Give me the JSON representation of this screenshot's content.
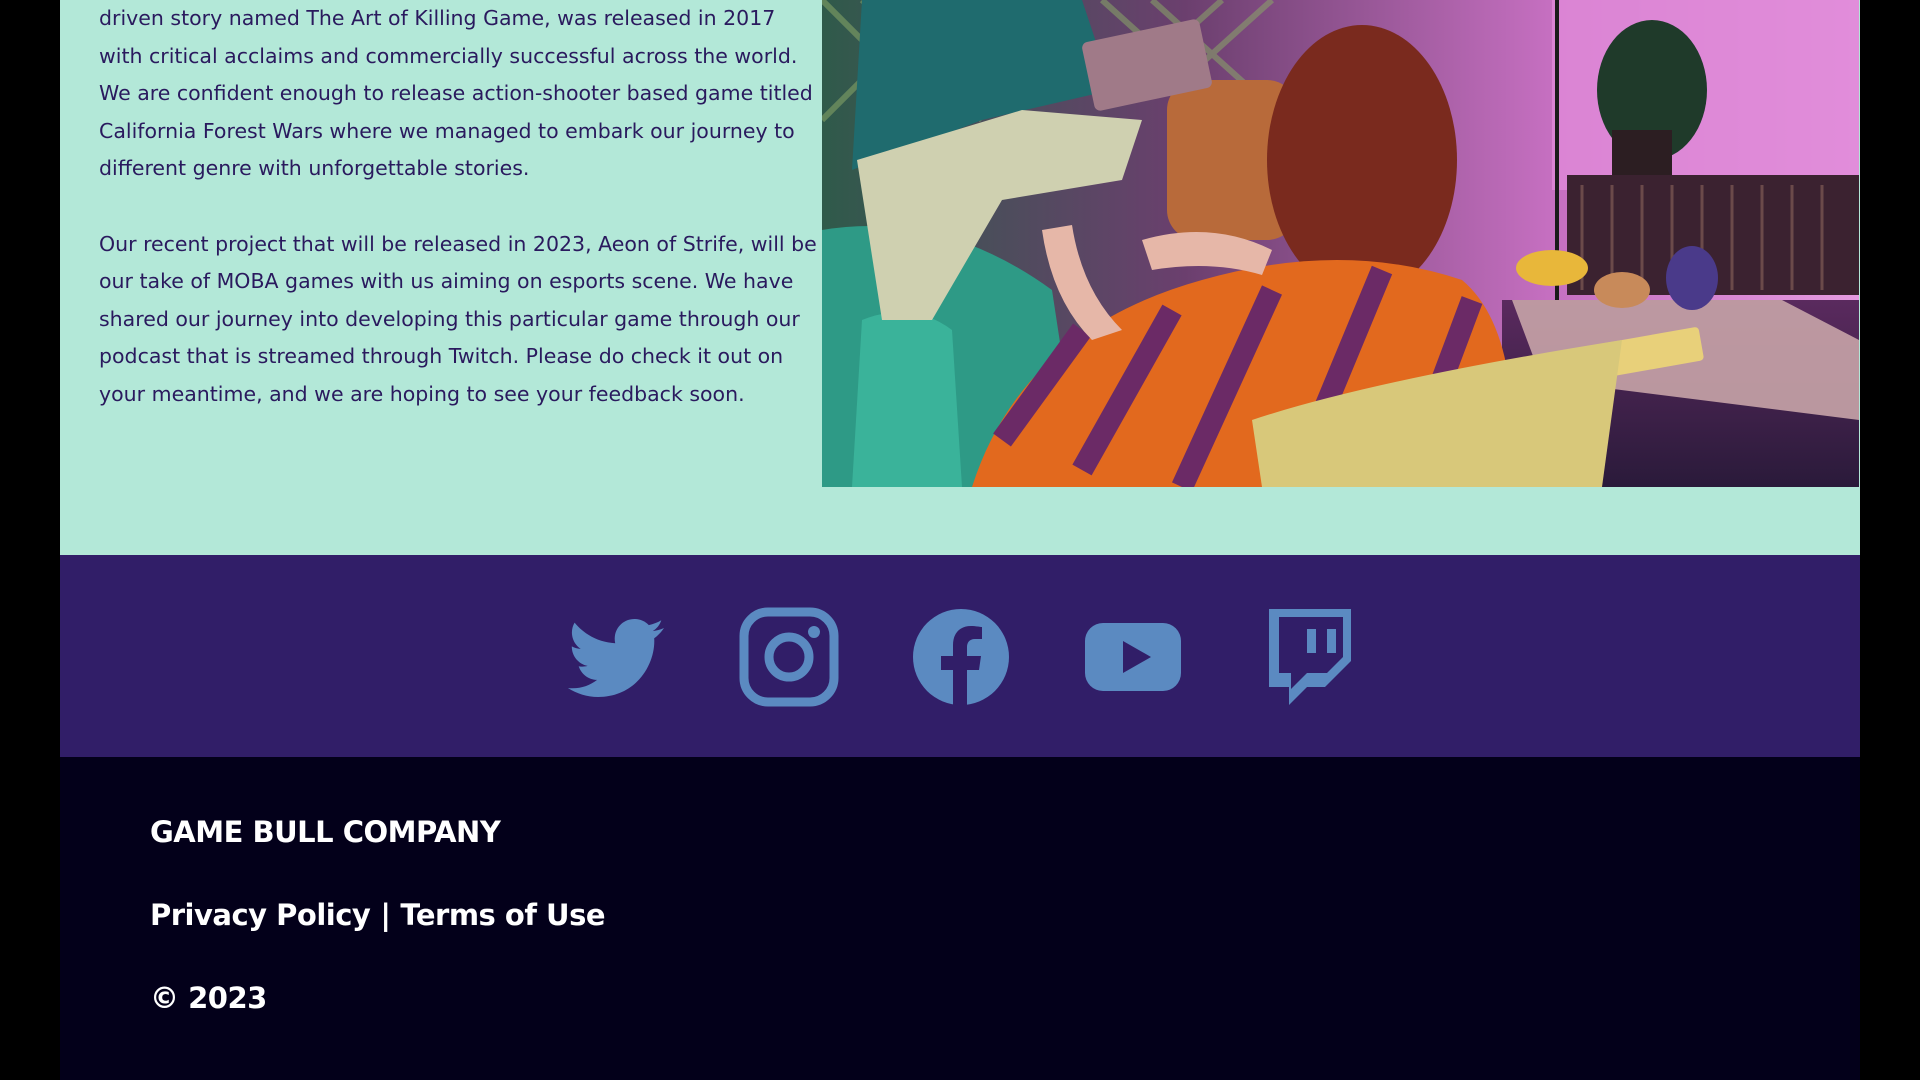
{
  "about": {
    "paragraph1": "driven story named The Art of Killing Game, was released in 2017 with critical acclaims and commercially successful across the world. We are confident enough to release action-shooter based game titled California Forest Wars where we managed to embark our journey to different genre with unforgettable stories.",
    "paragraph2": "Our recent project that will be released in 2023, Aeon of Strife, will be our take of MOBA games with us aiming on esports scene. We have shared our journey into developing this particular game through our podcast that is streamed through Twitch. Please do check it out on your meantime, and we are hoping to see your feedback soon."
  },
  "photo": {
    "subject": "people-in-living-room"
  },
  "social": {
    "icon_color": "#5b8ac1",
    "items": [
      {
        "name": "twitter",
        "icon": "twitter-icon"
      },
      {
        "name": "instagram",
        "icon": "instagram-icon"
      },
      {
        "name": "facebook",
        "icon": "facebook-icon"
      },
      {
        "name": "youtube",
        "icon": "youtube-icon"
      },
      {
        "name": "twitch",
        "icon": "twitch-icon"
      }
    ]
  },
  "footer": {
    "company": "GAME BULL COMPANY",
    "privacy": "Privacy Policy",
    "separator": "|",
    "terms": "Terms of Use",
    "copyright": "© 2023"
  },
  "colors": {
    "about_bg": "#b3e8d8",
    "text": "#2a1a5e",
    "social_bg": "#311e68",
    "footer_bg": "#03001a"
  }
}
